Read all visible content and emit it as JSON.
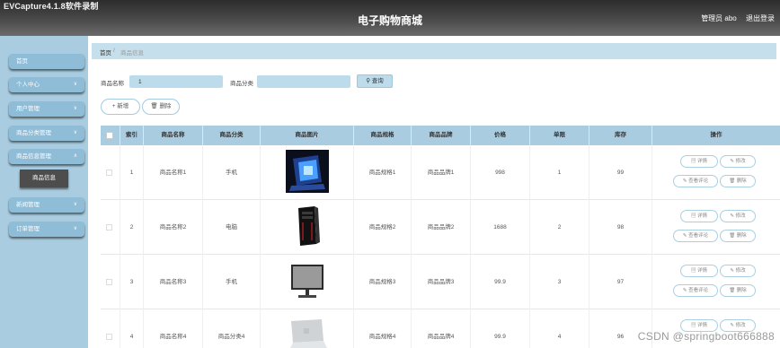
{
  "capture_title": "EVCapture4.1.8软件录制",
  "header": {
    "site_title": "电子购物商城",
    "user_label": "管理员 abo",
    "logout_label": "退出登录"
  },
  "sidebar": {
    "items": [
      {
        "label": "首页",
        "has_chevron": false
      },
      {
        "label": "个人中心",
        "has_chevron": true
      },
      {
        "label": "用户管理",
        "has_chevron": true
      },
      {
        "label": "商品分类管理",
        "has_chevron": true
      },
      {
        "label": "商品信息管理",
        "has_chevron": true
      },
      {
        "label": "新闻管理",
        "has_chevron": true
      },
      {
        "label": "订单管理",
        "has_chevron": true
      }
    ],
    "active_submenu": "商品信息"
  },
  "breadcrumb": {
    "home": "首页",
    "separator": "/",
    "current": "商品信息"
  },
  "search": {
    "name_label": "商品名称",
    "name_value": "1",
    "category_label": "商品分类",
    "category_value": "",
    "button_label": "查询",
    "button_icon": "search-icon"
  },
  "actions": {
    "add_label": "+ 新增",
    "delete_label": "删除"
  },
  "table": {
    "columns": [
      "索引",
      "商品名称",
      "商品分类",
      "商品图片",
      "商品规格",
      "商品品牌",
      "价格",
      "单限",
      "库存",
      "操作"
    ],
    "rows": [
      {
        "index": "1",
        "name": "商品名称1",
        "category": "手机",
        "image": "phone-case-image",
        "spec": "商品规格1",
        "brand": "商品品牌1",
        "price": "998",
        "limit": "1",
        "stock": "99"
      },
      {
        "index": "2",
        "name": "商品名称2",
        "category": "电脑",
        "image": "pc-tower-image",
        "spec": "商品规格2",
        "brand": "商品品牌2",
        "price": "1688",
        "limit": "2",
        "stock": "98"
      },
      {
        "index": "3",
        "name": "商品名称3",
        "category": "手机",
        "image": "monitor-image",
        "spec": "商品规格3",
        "brand": "商品品牌3",
        "price": "99.9",
        "limit": "3",
        "stock": "97"
      },
      {
        "index": "4",
        "name": "商品名称4",
        "category": "商品分类4",
        "image": "laptop-image",
        "spec": "商品规格4",
        "brand": "商品品牌4",
        "price": "99.9",
        "limit": "4",
        "stock": "96"
      }
    ],
    "row_actions": {
      "detail": "详情",
      "edit": "修改",
      "review": "查看评论",
      "delete": "删除"
    }
  },
  "watermark": "CSDN @springboot666888",
  "colors": {
    "header_dark": "#3c3c3c",
    "sidebar_bg": "#a9cce0",
    "menu_item": "#8fbcd6",
    "table_header": "#a9cce0",
    "accent_border": "#a9d0e2"
  }
}
